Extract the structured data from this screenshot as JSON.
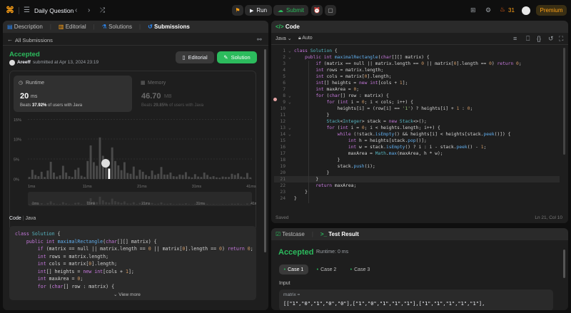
{
  "topbar": {
    "title": "Daily Question",
    "run": "Run",
    "submit": "Submit",
    "streak": "31",
    "premium": "Premium"
  },
  "left_tabs": [
    "Description",
    "Editorial",
    "Solutions",
    "Submissions"
  ],
  "all_submissions": "All Submissions",
  "result": {
    "status": "Accepted",
    "user": "Areeff",
    "submitted": "submitted at Apr 13, 2024 23:19",
    "editorial_btn": "Editorial",
    "solution_btn": "Solution"
  },
  "runtime": {
    "label": "Runtime",
    "value": "20",
    "unit": "ms",
    "beats_prefix": "Beats ",
    "beats_pct": "37.92%",
    "beats_suffix": " of users with Java"
  },
  "memory": {
    "label": "Memory",
    "value": "46.70",
    "unit": "MB",
    "beats_prefix": "Beats ",
    "beats_pct": "29.85%",
    "beats_suffix": " of users with Java"
  },
  "chart_data": {
    "type": "bar",
    "ylabels": [
      "15%",
      "10%",
      "5%",
      "0%"
    ],
    "xlabels": [
      "1ms",
      "11ms",
      "21ms",
      "31ms",
      "41ms"
    ],
    "mini_labels": [
      "1ms",
      "11ms",
      "21ms",
      "31ms",
      "41ms"
    ],
    "values": [
      0.5,
      2.3,
      1.0,
      0.7,
      1.8,
      0.5,
      2.1,
      4.3,
      1.6,
      0.6,
      0.9,
      3.3,
      1.6,
      0.7,
      0.5,
      2.3,
      2.8,
      0.8,
      0.5,
      4.5,
      8.4,
      4.2,
      3.3,
      10.4,
      5.8,
      3.3,
      2.6,
      7.9,
      4.5,
      3.4,
      2.2,
      4.2,
      1.5,
      1.3,
      3.1,
      0.8,
      2.3,
      1.8,
      1.0,
      0.7,
      2.1,
      1.0,
      1.3,
      3.0,
      1.1,
      1.1,
      1.6,
      0.7,
      0.6,
      1.1,
      1.0,
      1.7,
      0.6,
      0.4,
      1.2,
      0.6,
      0.5,
      1.6,
      1.0,
      0.5,
      0.7,
      0.4,
      0.3,
      0.6,
      0.5,
      0.5,
      1.3,
      1.0,
      1.4,
      0.6,
      0.4,
      1.5,
      0.4
    ],
    "ylim": [
      0,
      15
    ],
    "highlight_index": 26
  },
  "code_section": {
    "label": "Code",
    "lang": "Java",
    "view_more": "View more",
    "lines": [
      "class Solution {",
      "    public int maximalRectangle(char[][] matrix) {",
      "        if (matrix == null || matrix.length == 0 || matrix[0].length == 0) return 0;",
      "        int rows = matrix.length;",
      "        int cols = matrix[0].length;",
      "        int[] heights = new int[cols + 1];",
      "        int maxArea = 0;",
      "        for (char[] row : matrix) {"
    ]
  },
  "editor": {
    "tab": "Code",
    "lang": "Java",
    "auto": "Auto",
    "saved": "Saved",
    "pos": "Ln 21, Col 10",
    "lines": [
      "class Solution {",
      "    public int maximalRectangle(char[][] matrix) {",
      "        if (matrix == null || matrix.length == 0 || matrix[0].length == 0) return 0;",
      "        int rows = matrix.length;",
      "        int cols = matrix[0].length;",
      "        int[] heights = new int[cols + 1];",
      "        int maxArea = 0;",
      "        for (char[] row : matrix) {",
      "            for (int i = 0; i < cols; i++) {",
      "                heights[i] = (row[i] == '1') ? heights[i] + 1 : 0;",
      "            }",
      "            Stack<Integer> stack = new Stack<>();",
      "            for (int i = 0; i < heights.length; i++) {",
      "                while (!stack.isEmpty() && heights[i] < heights[stack.peek()]) {",
      "                    int h = heights[stack.pop()];",
      "                    int w = stack.isEmpty() ? i : i - stack.peek() - 1;",
      "                    maxArea = Math.max(maxArea, h * w);",
      "                }",
      "                stack.push(i);",
      "            }",
      "        }",
      "        return maxArea;",
      "    }",
      "}"
    ]
  },
  "testpanel": {
    "tab1": "Testcase",
    "tab2": "Test Result",
    "status": "Accepted",
    "runtime": "Runtime: 0 ms",
    "cases": [
      "Case 1",
      "Case 2",
      "Case 3"
    ],
    "input_label": "Input",
    "var": "matrix =",
    "value": "[[\"1\",\"0\",\"1\",\"0\",\"0\"],[\"1\",\"0\",\"1\",\"1\",\"1\"],[\"1\",\"1\",\"1\",\"1\",\"1\"],"
  },
  "colors": {
    "accent": "#2cbb5d",
    "orange": "#ffa116",
    "bg": "#0f0f0f",
    "panel": "#1e1e1e"
  }
}
